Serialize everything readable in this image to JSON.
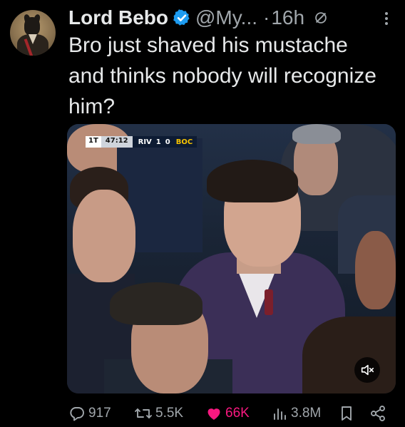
{
  "tweet": {
    "author": {
      "display_name": "Lord Bebo",
      "handle": "@My...",
      "verified": true,
      "avatar_icon": "avatar-dog-portrait"
    },
    "separator": "·",
    "timestamp": "16h",
    "text": "Bro just shaved his mustache and thinks nobody will recognize him?",
    "media": {
      "type": "video",
      "scorebug": {
        "period": "1T",
        "clock": "47:12",
        "home_team": "RIV",
        "home_score": "1",
        "away_score": "0",
        "away_team": "BOC"
      },
      "mute_icon": "muted-speaker-icon"
    },
    "actions": {
      "replies": "917",
      "reposts": "5.5K",
      "likes": "66K",
      "views": "3.8M"
    }
  },
  "colors": {
    "background": "#000000",
    "primary_text": "#e7e9ea",
    "secondary_text": "#a0a6ab",
    "verified_blue": "#1d9bf0",
    "like_pink": "#f91880"
  }
}
